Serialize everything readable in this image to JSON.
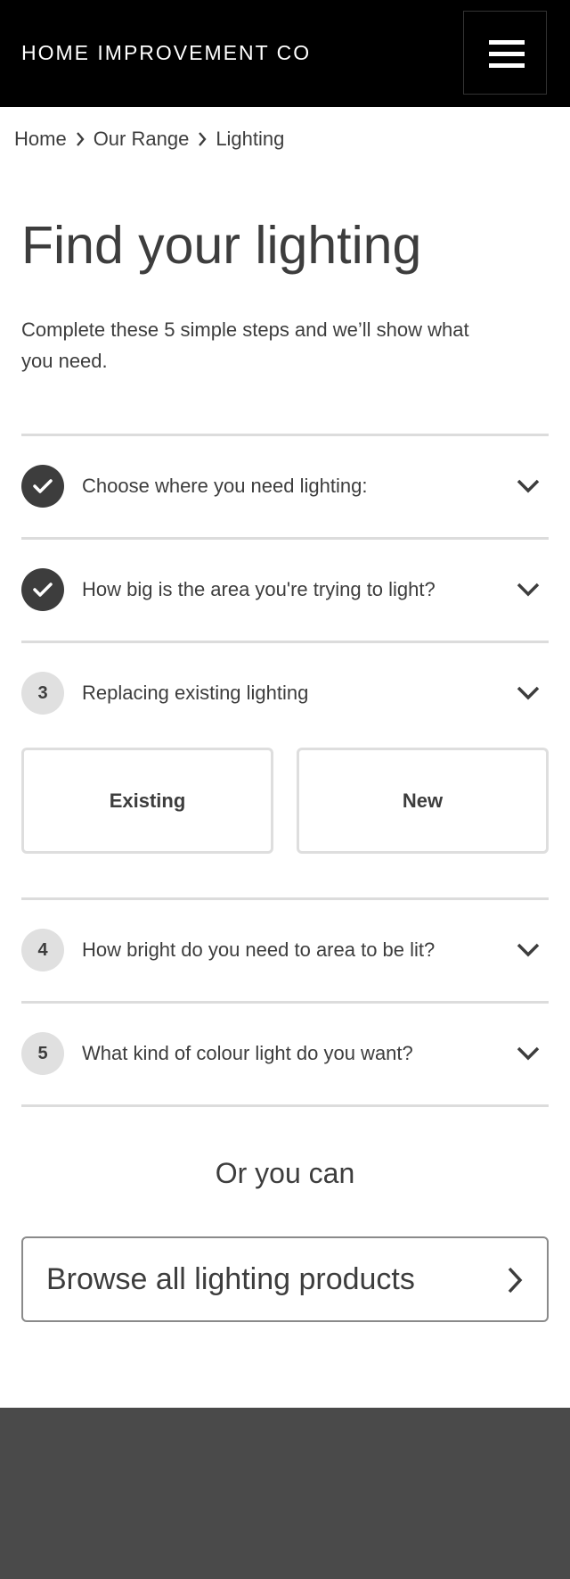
{
  "header": {
    "brand": "HOME IMPROVEMENT CO",
    "menu_icon": "hamburger-menu-icon"
  },
  "breadcrumb": [
    {
      "label": "Home"
    },
    {
      "label": "Our Range"
    },
    {
      "label": "Lighting"
    }
  ],
  "page": {
    "title": "Find your lighting",
    "intro": "Complete these 5 simple steps and we’ll show what you need."
  },
  "steps": [
    {
      "number": "1",
      "status": "done",
      "label": "Choose where you need lighting:",
      "icon": "check-icon"
    },
    {
      "number": "2",
      "status": "done",
      "label": "How big is the area you're trying to light?",
      "icon": "check-icon"
    },
    {
      "number": "3",
      "status": "active",
      "label": "Replacing existing lighting"
    },
    {
      "number": "4",
      "status": "todo",
      "label": "How bright do you need to area to be lit?"
    },
    {
      "number": "5",
      "status": "todo",
      "label": "What kind of colour light do you want?"
    }
  ],
  "step3_options": [
    "Existing",
    "New"
  ],
  "alternative": {
    "text": "Or you can",
    "browse_label": "Browse all lighting products"
  },
  "colors": {
    "header_bg": "#000000",
    "text": "#3d3d3d",
    "done_circle": "#3d3d3d",
    "todo_circle": "#e0e0e0",
    "divider": "#dcdcdc",
    "footer_bg": "#4a4a4a"
  }
}
